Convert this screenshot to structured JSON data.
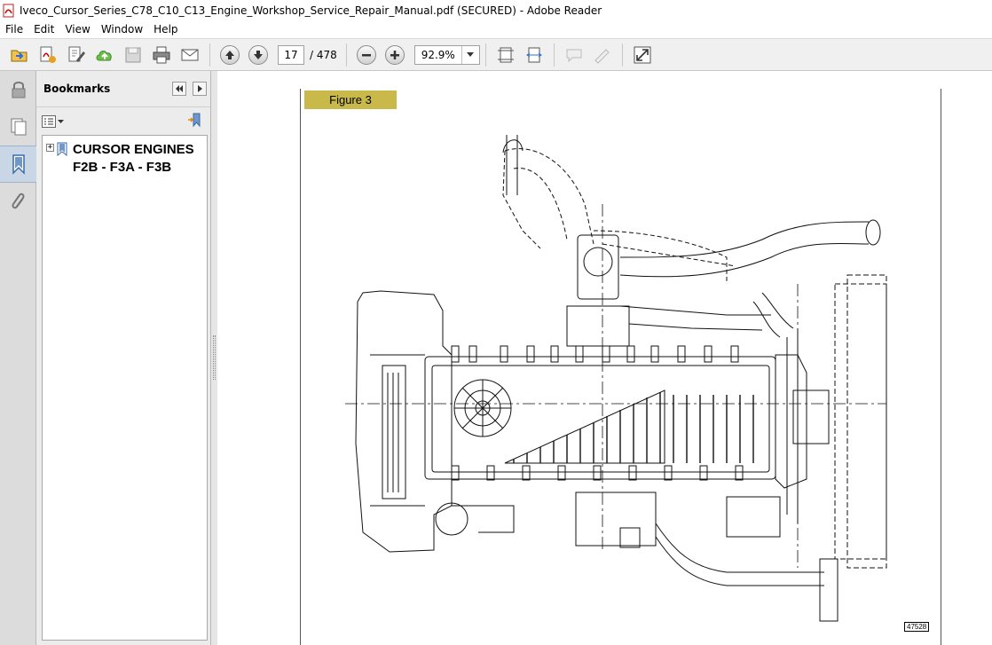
{
  "window": {
    "title": "Iveco_Cursor_Series_C78_C10_C13_Engine_Workshop_Service_Repair_Manual.pdf (SECURED) - Adobe Reader"
  },
  "menu": {
    "items": [
      "File",
      "Edit",
      "View",
      "Window",
      "Help"
    ]
  },
  "toolbar": {
    "page_current": "17",
    "page_total": "/ 478",
    "zoom": "92.9%"
  },
  "bookmarks": {
    "title": "Bookmarks",
    "items": [
      {
        "label": "CURSOR ENGINES\nF2B - F3A - F3B",
        "expand": "+"
      }
    ]
  },
  "document": {
    "figure_label": "Figure 3",
    "figure_id": "47528"
  },
  "colors": {
    "figure_label_bg": "#c9b94a",
    "active_rail": "#c8d6e5"
  }
}
